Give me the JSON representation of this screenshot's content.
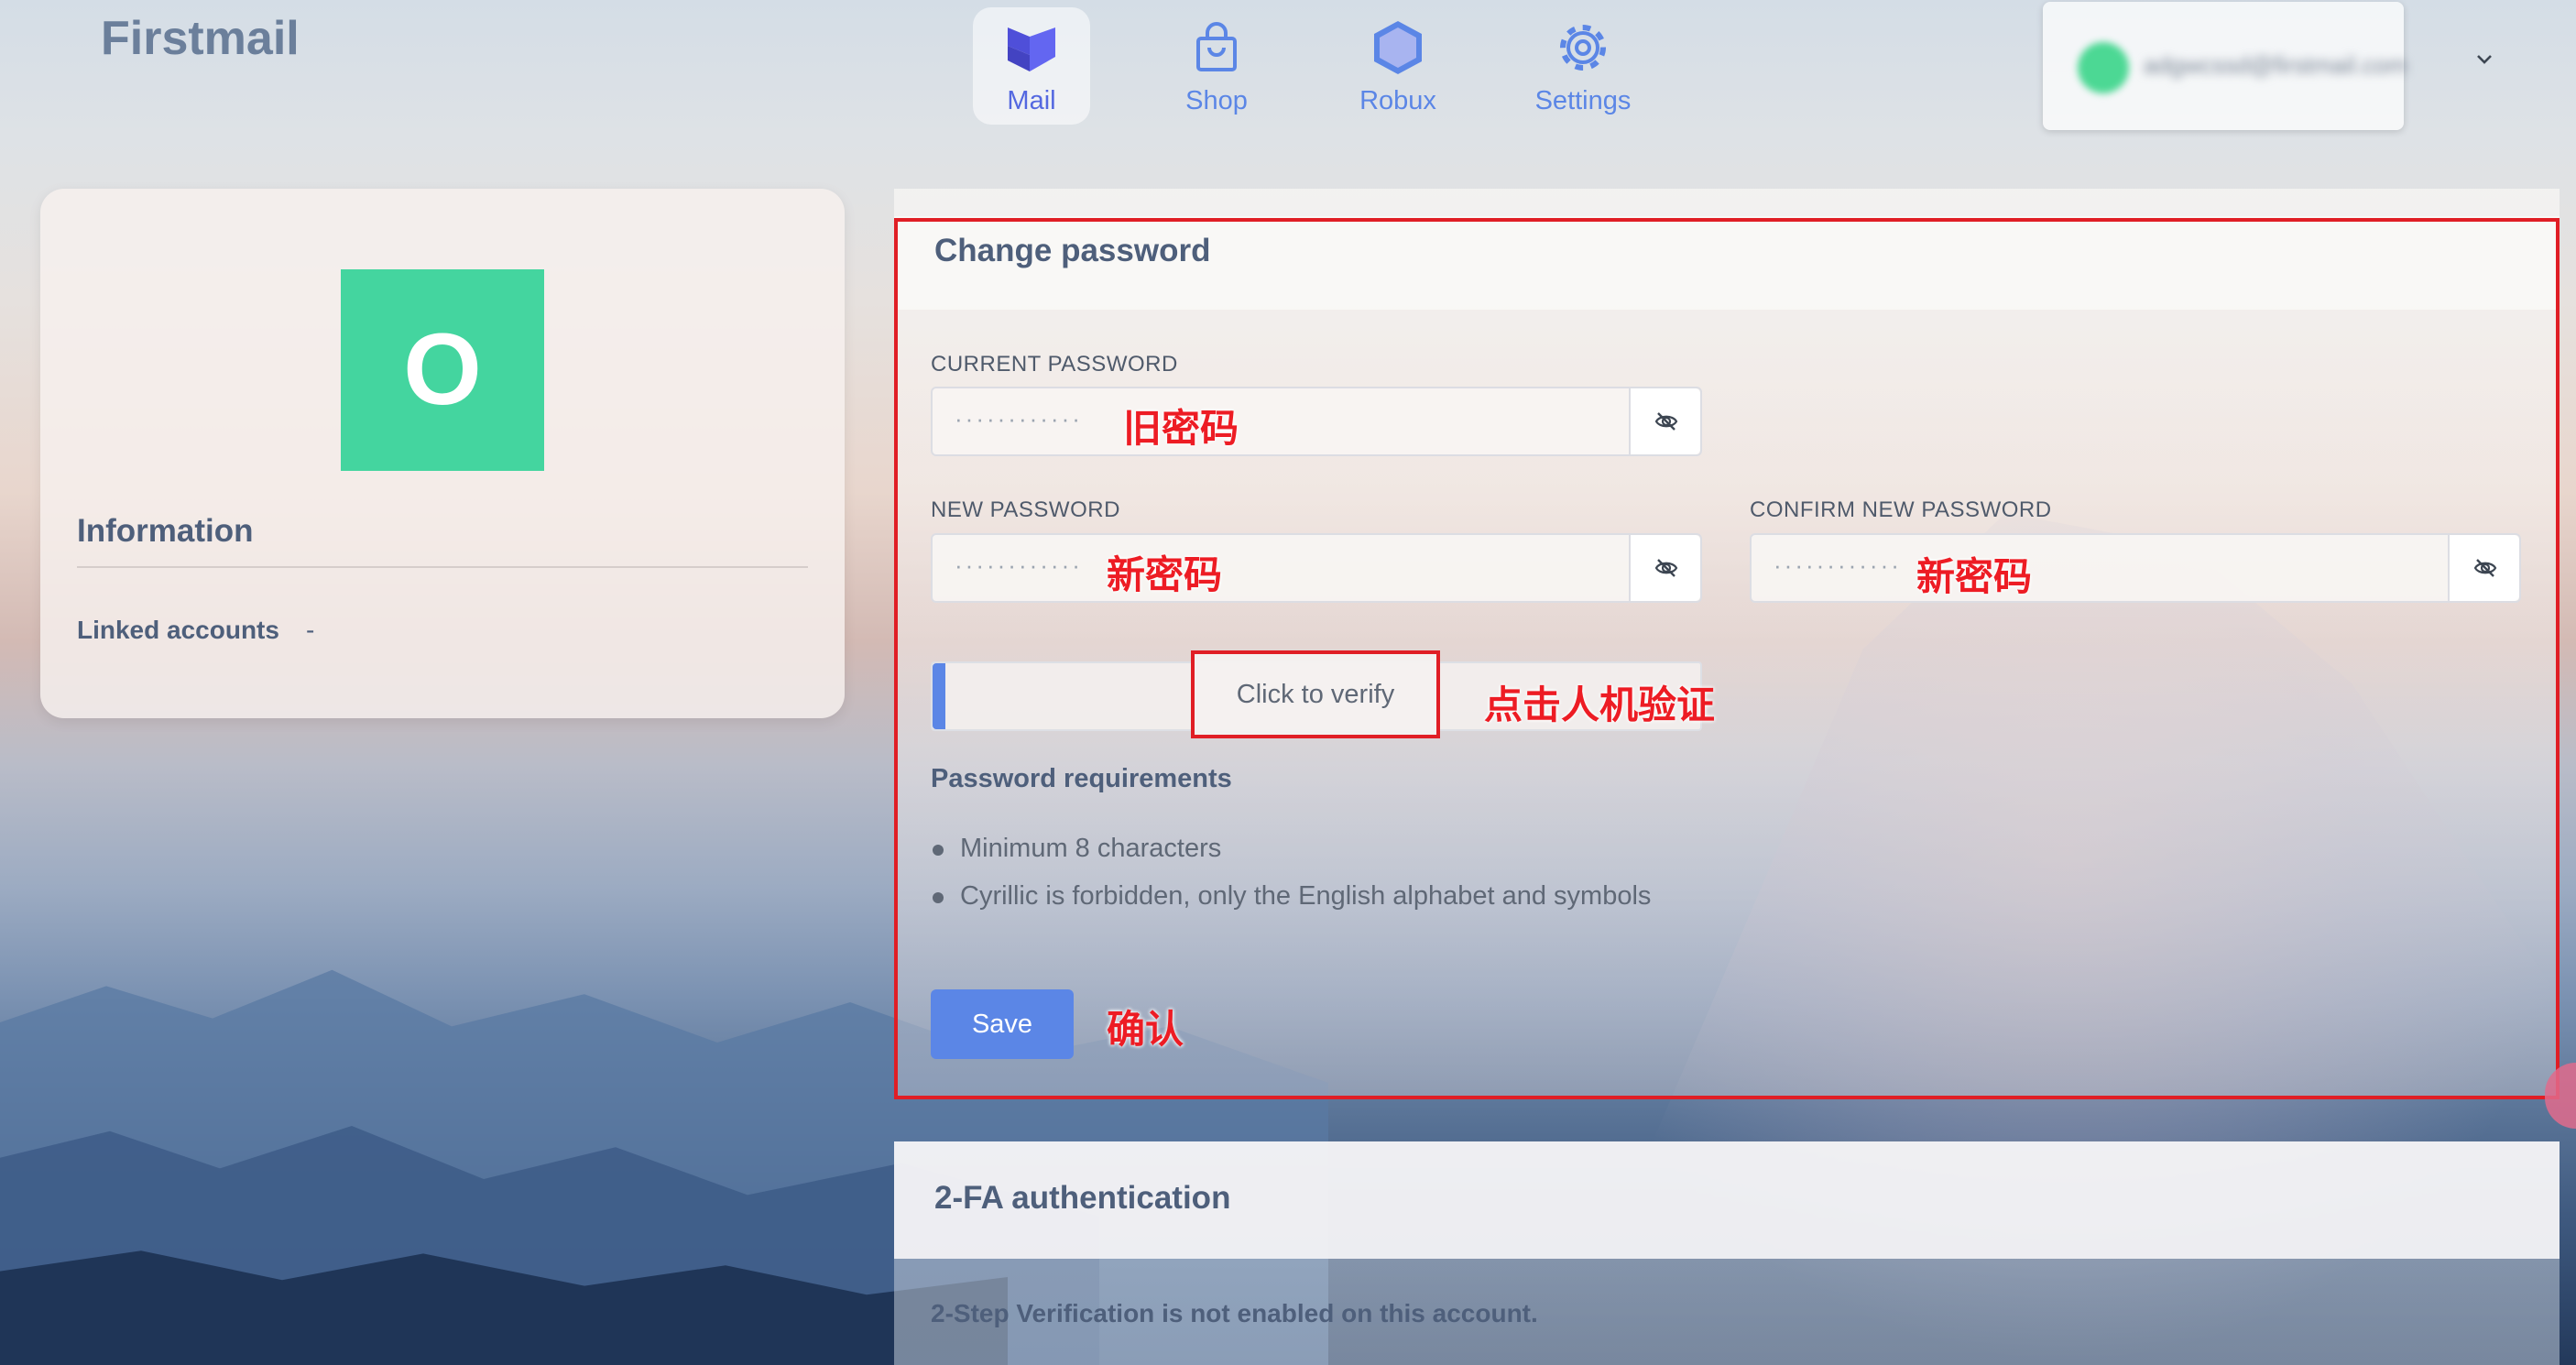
{
  "app": {
    "title": "Firstmail"
  },
  "nav": [
    {
      "label": "Mail",
      "icon": "mail-logo-icon",
      "active": true
    },
    {
      "label": "Shop",
      "icon": "shopping-bag-icon",
      "active": false
    },
    {
      "label": "Robux",
      "icon": "hexagon-icon",
      "active": false
    },
    {
      "label": "Settings",
      "icon": "gear-icon",
      "active": false
    }
  ],
  "account": {
    "email": "adgwcssd@firstmail.com",
    "avatar_color": "#4cd894"
  },
  "profile": {
    "avatar_letter": "O",
    "avatar_color": "#44d59f",
    "info_heading": "Information",
    "linked_accounts_label": "Linked accounts",
    "linked_accounts_value": "-"
  },
  "change_password": {
    "title": "Change password",
    "current_label": "CURRENT PASSWORD",
    "current_value": "············",
    "new_label": "NEW PASSWORD",
    "new_value": "············",
    "confirm_label": "CONFIRM NEW PASSWORD",
    "confirm_value": "············",
    "verify_label": "Click to verify",
    "requirements_heading": "Password requirements",
    "requirements": [
      "Minimum 8 characters",
      "Cyrillic is forbidden, only the English alphabet and symbols"
    ],
    "save_label": "Save"
  },
  "annotations": {
    "old_password": "旧密码",
    "new_password": "新密码",
    "confirm_password": "新密码",
    "captcha": "点击人机验证",
    "confirm": "确认",
    "color": "#ed1c24"
  },
  "two_fa": {
    "title": "2-FA authentication",
    "status": "2-Step Verification is not enabled on this account."
  },
  "colors": {
    "accent": "#5b86e6",
    "highlight_frame": "#e01e25"
  }
}
